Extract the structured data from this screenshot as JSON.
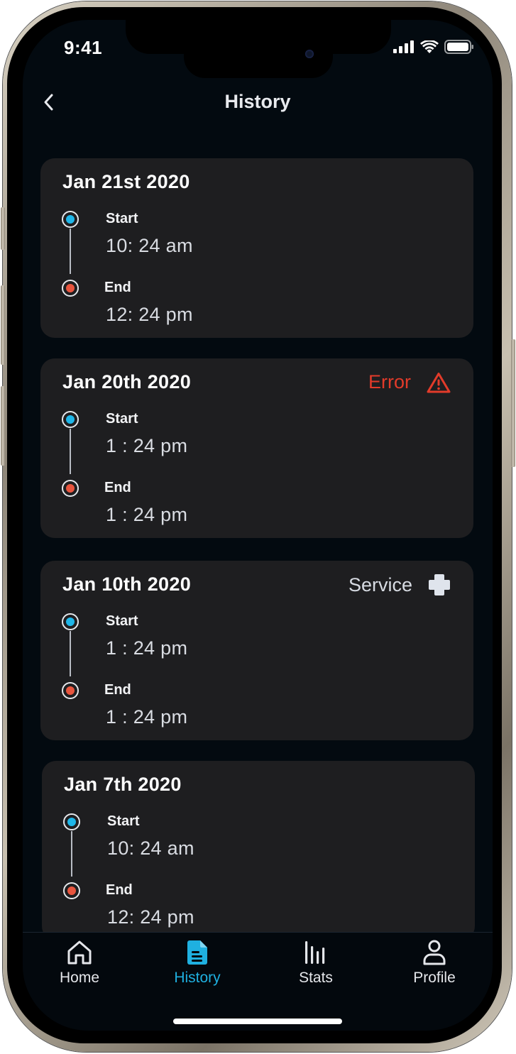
{
  "status_bar": {
    "time": "9:41",
    "icons": [
      "cellular-signal-icon",
      "wifi-icon",
      "battery-icon"
    ]
  },
  "header": {
    "back_icon": "chevron-left-icon",
    "title": "History"
  },
  "entries": [
    {
      "date": "Jan 21st 2020",
      "start_label": "Start",
      "start_time": "10: 24 am",
      "end_label": "End",
      "end_time": "12: 24 pm",
      "tag": null
    },
    {
      "date": "Jan 20th 2020",
      "start_label": "Start",
      "start_time": "1 : 24 pm",
      "end_label": "End",
      "end_time": "1 : 24 pm",
      "tag": {
        "label": "Error",
        "icon": "warning-triangle-icon",
        "color": "#e23b2a"
      }
    },
    {
      "date": "Jan 10th 2020",
      "start_label": "Start",
      "start_time": "1 : 24 pm",
      "end_label": "End",
      "end_time": "1 : 24 pm",
      "tag": {
        "label": "Service",
        "icon": "plus-cross-icon",
        "color": "#d7dbe2"
      }
    },
    {
      "date": "Jan 7th 2020",
      "start_label": "Start",
      "start_time": "10: 24 am",
      "end_label": "End",
      "end_time": "12: 24 pm",
      "tag": null
    }
  ],
  "tabs": [
    {
      "label": "Home",
      "icon": "home-icon",
      "active": false
    },
    {
      "label": "History",
      "icon": "document-icon",
      "active": true
    },
    {
      "label": "Stats",
      "icon": "bar-chart-icon",
      "active": false
    },
    {
      "label": "Profile",
      "icon": "person-icon",
      "active": false
    }
  ],
  "colors": {
    "background": "#030a10",
    "card": "#1e1e20",
    "accent": "#1fb0e0",
    "start_dot": "#1fb6e8",
    "end_dot": "#e8553e",
    "error": "#e23b2a"
  }
}
